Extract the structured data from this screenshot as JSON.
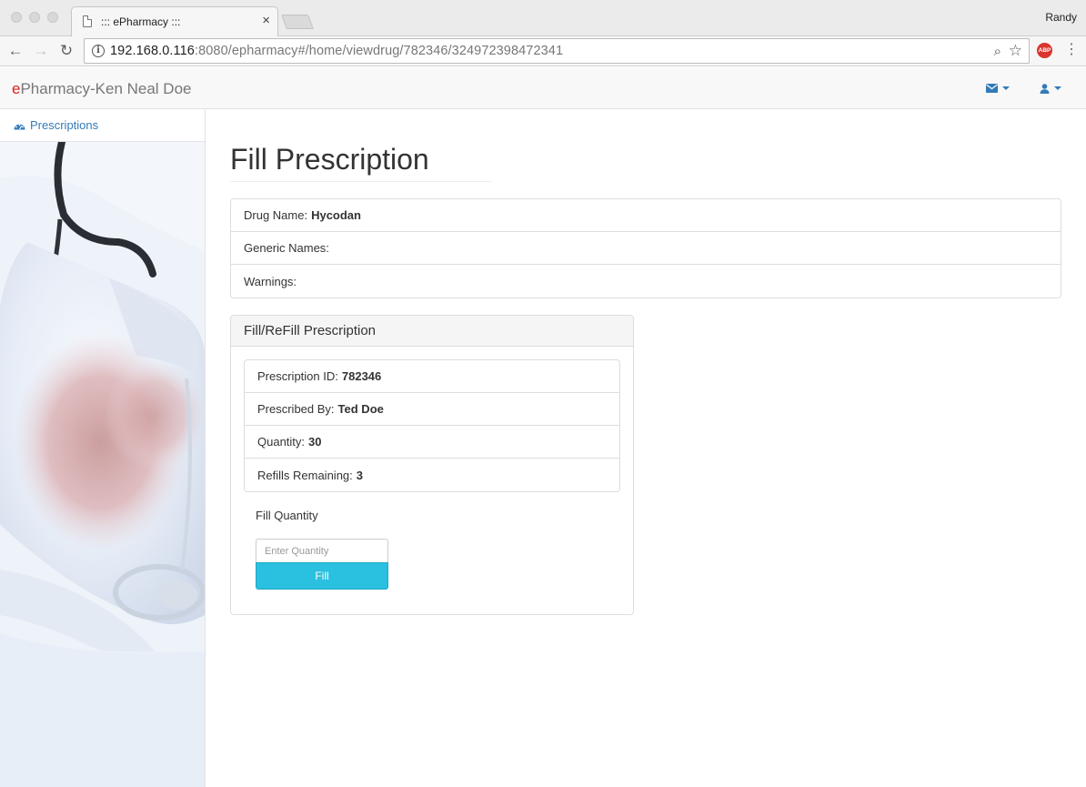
{
  "browser": {
    "tab_title": "::: ePharmacy :::",
    "tab_close": "×",
    "profile_name": "Randy",
    "url_host": "192.168.0.116",
    "url_rest": ":8080/epharmacy#/home/viewdrug/782346/324972398472341",
    "info_glyph": "i",
    "back_glyph": "←",
    "forward_glyph": "→",
    "reload_glyph": "↻",
    "zoom_glyph": "⌕",
    "star_glyph": "☆",
    "extension_label": "ABP",
    "menu_glyph": "⋮"
  },
  "navbar": {
    "brand_prefix": "e",
    "brand_rest": "Pharmacy-Ken Neal Doe"
  },
  "sidebar": {
    "items": [
      {
        "label": "Prescriptions",
        "icon": "dashboard-icon"
      }
    ]
  },
  "main": {
    "title": "Fill Prescription",
    "drug_info": [
      {
        "label": "Drug Name:",
        "value": "Hycodan"
      },
      {
        "label": "Generic Names:",
        "value": ""
      },
      {
        "label": "Warnings:",
        "value": ""
      }
    ],
    "panel": {
      "heading": "Fill/ReFill Prescription",
      "details": [
        {
          "label": "Prescription ID:",
          "value": "782346"
        },
        {
          "label": "Prescribed By:",
          "value": "Ted Doe"
        },
        {
          "label": "Quantity:",
          "value": "30"
        },
        {
          "label": "Refills Remaining:",
          "value": "3"
        }
      ],
      "fill_label": "Fill Quantity",
      "quantity_placeholder": "Enter Quantity",
      "fill_button": "Fill"
    }
  },
  "colors": {
    "link": "#337ab7",
    "brand_accent": "#d9231d",
    "fill_button": "#2ac0e0"
  }
}
